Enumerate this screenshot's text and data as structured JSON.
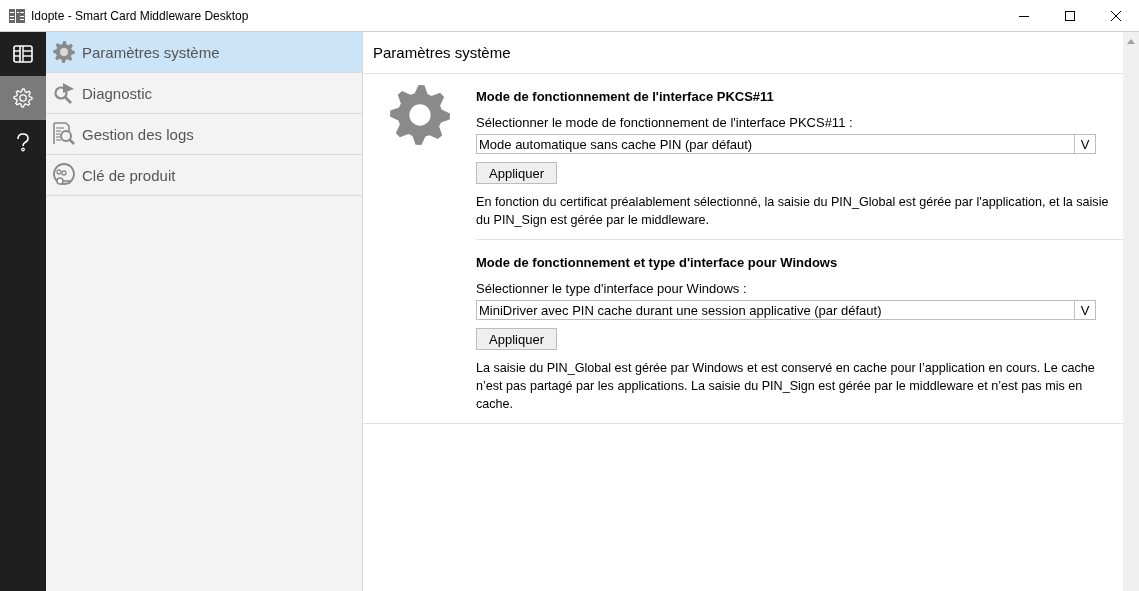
{
  "window": {
    "title": "Idopte - Smart Card Middleware Desktop"
  },
  "rail": [
    {
      "selected": false
    },
    {
      "selected": true
    },
    {
      "selected": false
    }
  ],
  "sidebar": {
    "items": [
      {
        "label": "Paramètres système",
        "selected": true
      },
      {
        "label": "Diagnostic",
        "selected": false
      },
      {
        "label": "Gestion des logs",
        "selected": false
      },
      {
        "label": "Clé de produit",
        "selected": false
      }
    ]
  },
  "content": {
    "title": "Paramètres système",
    "sections": [
      {
        "heading": "Mode de fonctionnement de l'interface PKCS#11",
        "label": "Sélectionner le mode de fonctionnement de l'interface PKCS#11 :",
        "dropdown": "Mode automatique sans cache PIN (par défaut)",
        "dropdown_arrow": "V",
        "button": "Appliquer",
        "description": "En fonction du certificat préalablement sélectionné, la saisie du PIN_Global est gérée par l'application, et la saisie du PIN_Sign est gérée par le middleware."
      },
      {
        "heading": "Mode de fonctionnement et type d'interface pour Windows",
        "label": "Sélectionner le type d'interface pour Windows :",
        "dropdown": "MiniDriver avec PIN cache durant une session applicative (par défaut)",
        "dropdown_arrow": "V",
        "button": "Appliquer",
        "description": "La saisie du PIN_Global est gérée par Windows et est conservé en cache pour l’application en cours. Le cache n’est pas partagé par les applications. La saisie du PIN_Sign est gérée par le middleware et n’est pas mis en cache."
      }
    ]
  }
}
